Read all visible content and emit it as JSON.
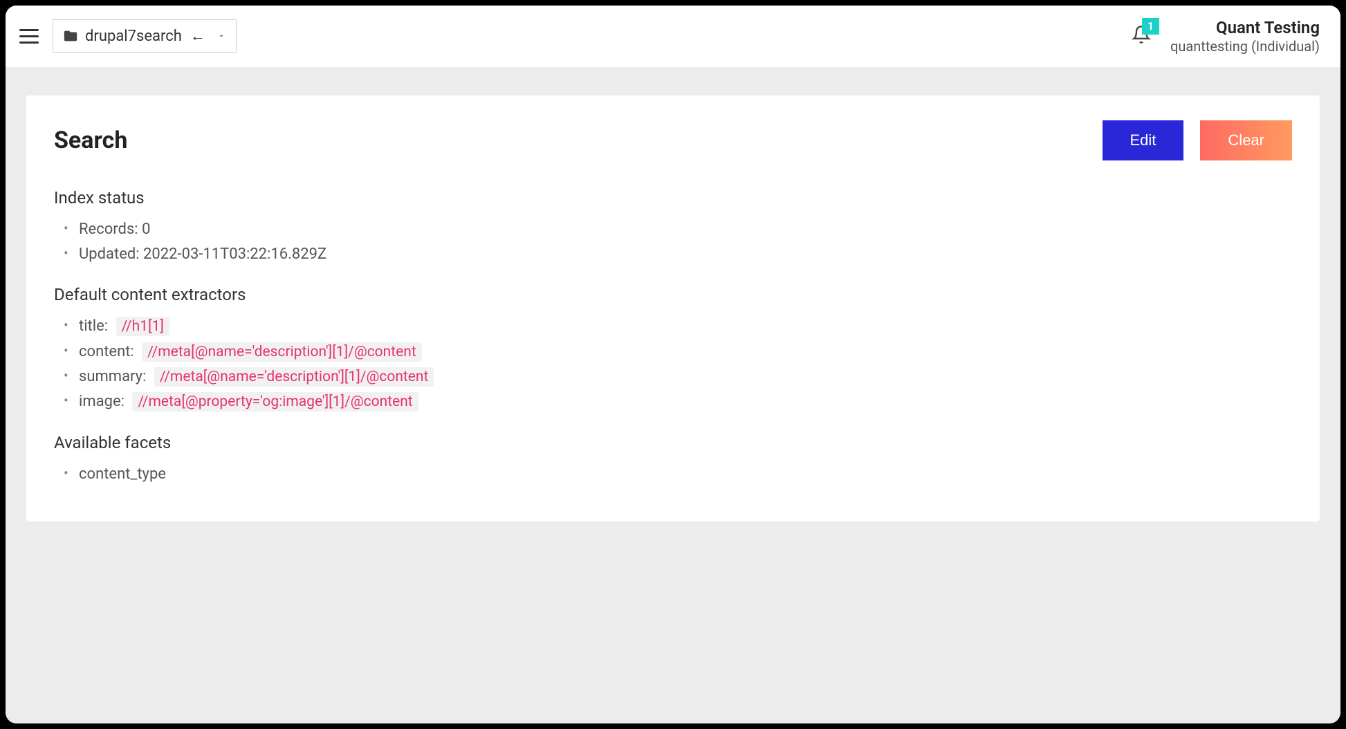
{
  "topbar": {
    "project_name": "drupal7search",
    "notification_count": "1",
    "account_name": "Quant Testing",
    "account_sub": "quanttesting (Individual)"
  },
  "page": {
    "title": "Search",
    "edit_label": "Edit",
    "clear_label": "Clear"
  },
  "index_status": {
    "heading": "Index status",
    "records_label": "Records: 0",
    "updated_label": "Updated: 2022-03-11T03:22:16.829Z"
  },
  "extractors": {
    "heading": "Default content extractors",
    "items": [
      {
        "label": "title:",
        "value": "//h1[1]"
      },
      {
        "label": "content:",
        "value": "//meta[@name='description'][1]/@content"
      },
      {
        "label": "summary:",
        "value": "//meta[@name='description'][1]/@content"
      },
      {
        "label": "image:",
        "value": "//meta[@property='og:image'][1]/@content"
      }
    ]
  },
  "facets": {
    "heading": "Available facets",
    "items": [
      "content_type"
    ]
  }
}
